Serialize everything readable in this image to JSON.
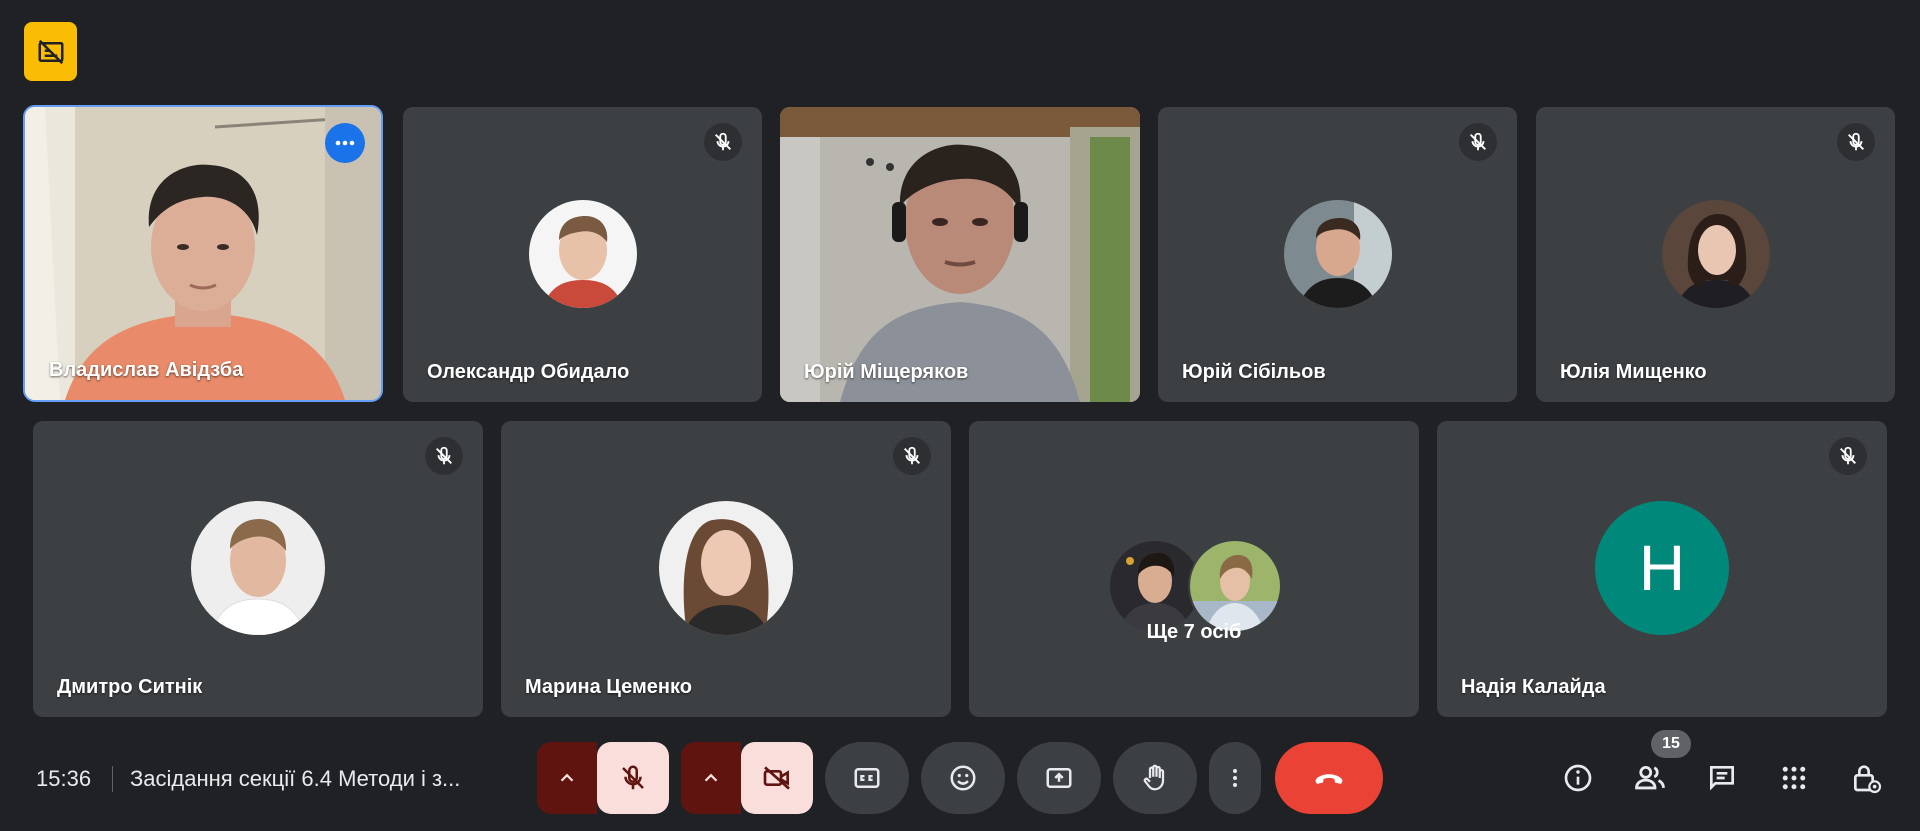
{
  "participants_row1": [
    {
      "name": "Владислав Авідзба",
      "type": "video",
      "active": true
    },
    {
      "name": "Олександр Обидало",
      "type": "avatar",
      "muted": true
    },
    {
      "name": "Юрій Міщеряков",
      "type": "video"
    },
    {
      "name": "Юрій Сібільов",
      "type": "avatar",
      "muted": true
    },
    {
      "name": "Юлія Мищенко",
      "type": "avatar",
      "muted": true
    }
  ],
  "participants_row2": [
    {
      "name": "Дмитро Ситнік",
      "type": "avatar",
      "muted": true
    },
    {
      "name": "Марина Цеменко",
      "type": "avatar",
      "muted": true
    },
    {
      "label": "Ще 7 осіб",
      "type": "group"
    },
    {
      "name": "Надія Калайда",
      "type": "letter",
      "letter": "Н",
      "muted": true
    }
  ],
  "bottom_bar": {
    "time": "15:36",
    "meeting_title": "Засідання секції 6.4 Методи і з...",
    "participants_count": "15"
  },
  "colors": {
    "background": "#202124",
    "tile": "#3c4043",
    "accent_blue": "#1a73e8",
    "end_call": "#ea4335",
    "rec_badge": "#fbbc04",
    "letter_avatar": "#00897b",
    "muted_control_bg": "#f9dedc",
    "muted_control_chevron": "#601410"
  },
  "icons": [
    "recording-off-icon",
    "mic-off-icon",
    "more-options-icon",
    "chevron-up-icon",
    "camera-off-icon",
    "captions-icon",
    "emoji-icon",
    "present-icon",
    "raise-hand-icon",
    "more-vert-icon",
    "end-call-icon",
    "info-icon",
    "people-icon",
    "chat-icon",
    "activities-icon",
    "host-controls-icon"
  ]
}
